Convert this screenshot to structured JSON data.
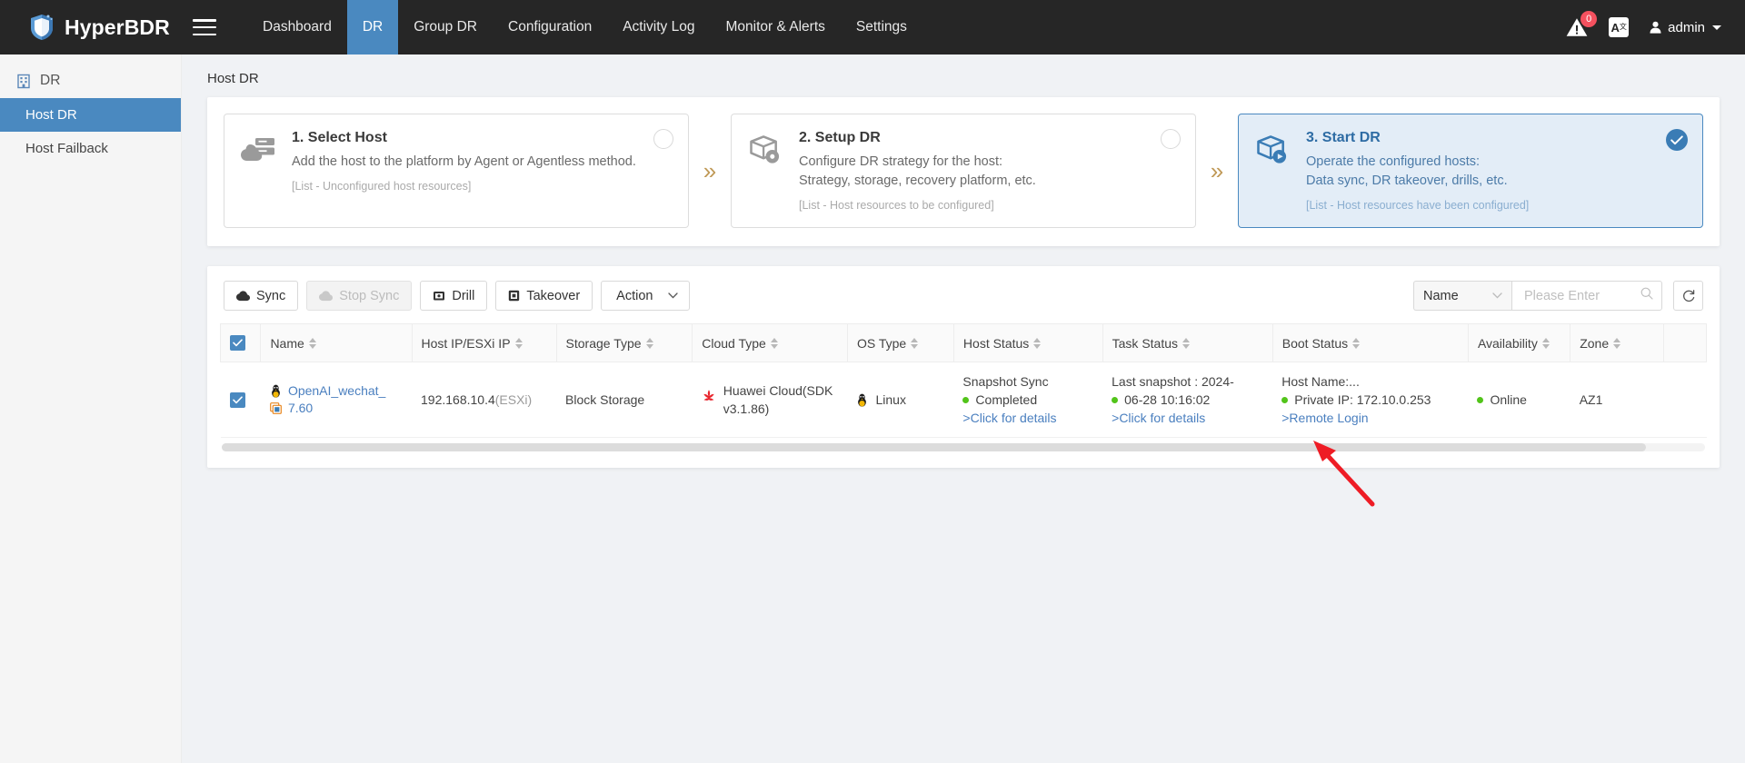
{
  "header": {
    "brand": "HyperBDR",
    "menu_icon": "hamburger-icon",
    "nav": [
      {
        "label": "Dashboard",
        "active": false
      },
      {
        "label": "DR",
        "active": true
      },
      {
        "label": "Group DR",
        "active": false
      },
      {
        "label": "Configuration",
        "active": false
      },
      {
        "label": "Activity Log",
        "active": false
      },
      {
        "label": "Monitor & Alerts",
        "active": false
      },
      {
        "label": "Settings",
        "active": false
      }
    ],
    "alert_badge": "0",
    "lang_label": "A",
    "lang_sup": "文",
    "user": "admin",
    "accent": "#4a89c0"
  },
  "sidebar": {
    "group_label": "DR",
    "items": [
      {
        "label": "Host DR",
        "active": true
      },
      {
        "label": "Host Failback",
        "active": false
      }
    ]
  },
  "breadcrumb": "Host DR",
  "steps": [
    {
      "title": "1. Select Host",
      "desc_lines": [
        "Add the host to the platform by Agent or Agentless method."
      ],
      "note": "[List - Unconfigured host resources]",
      "state": "circle",
      "icon": "cloud-host-icon"
    },
    {
      "title": "2. Setup DR",
      "desc_lines": [
        "Configure DR strategy for the host:",
        "Strategy, storage, recovery platform, etc."
      ],
      "note": "[List - Host resources to be configured]",
      "state": "circle",
      "icon": "box-settings-icon"
    },
    {
      "title": "3. Start DR",
      "desc_lines": [
        "Operate the configured hosts:",
        "Data sync, DR takeover, drills, etc."
      ],
      "note": "[List - Host resources have been configured]",
      "state": "check",
      "icon": "box-play-icon"
    }
  ],
  "step_separator": "»",
  "toolbar": {
    "buttons": [
      {
        "label": "Sync",
        "icon": "cloud-sync-icon",
        "disabled": false
      },
      {
        "label": "Stop Sync",
        "icon": "cloud-stop-icon",
        "disabled": true
      },
      {
        "label": "Drill",
        "icon": "drill-box-icon",
        "disabled": false
      },
      {
        "label": "Takeover",
        "icon": "takeover-box-icon",
        "disabled": false
      },
      {
        "label": "Action",
        "icon": "chevron-down-icon",
        "disabled": false
      }
    ],
    "filter_field": "Name",
    "search_placeholder": "Please Enter",
    "search_value": "",
    "refresh_icon": "refresh-icon"
  },
  "table": {
    "columns": [
      {
        "label": "Name",
        "sortable": true
      },
      {
        "label": "Host IP/ESXi IP",
        "sortable": true
      },
      {
        "label": "Storage Type",
        "sortable": true
      },
      {
        "label": "Cloud Type",
        "sortable": true
      },
      {
        "label": "OS Type",
        "sortable": true
      },
      {
        "label": "Host Status",
        "sortable": true
      },
      {
        "label": "Task Status",
        "sortable": true
      },
      {
        "label": "Boot Status",
        "sortable": true
      },
      {
        "label": "Availability",
        "sortable": true
      },
      {
        "label": "Zone",
        "sortable": true
      }
    ],
    "header_checked": true,
    "rows": [
      {
        "checked": true,
        "name_line1": "OpenAI_wechat_",
        "name_line2": "7.60",
        "name_icon1": "linux-penguin-icon",
        "name_icon2": "vm-clone-icon",
        "host_ip": "192.168.10.4",
        "host_ip_suffix": "(ESXi)",
        "storage_type": "Block Storage",
        "cloud_type_line1": "Huawei Cloud(SDK",
        "cloud_type_line2": "v3.1.86)",
        "cloud_icon": "huawei-cloud-icon",
        "os_type": "Linux",
        "os_icon": "linux-penguin-icon",
        "host_status_title": "Snapshot Sync",
        "host_status_value": "Completed",
        "host_status_link": ">Click for details",
        "task_status_title": "Last snapshot : 2024-",
        "task_status_value": "06-28 10:16:02",
        "task_status_link": ">Click for details",
        "boot_status_title": "Host Name:...",
        "boot_status_value": "Private IP: 172.10.0.253",
        "boot_status_link": ">Remote Login",
        "availability": "Online",
        "zone": "AZ1"
      }
    ]
  },
  "annotation": {
    "type": "red-arrow",
    "points_to": ">Remote Login",
    "color": "#ee1c25"
  }
}
